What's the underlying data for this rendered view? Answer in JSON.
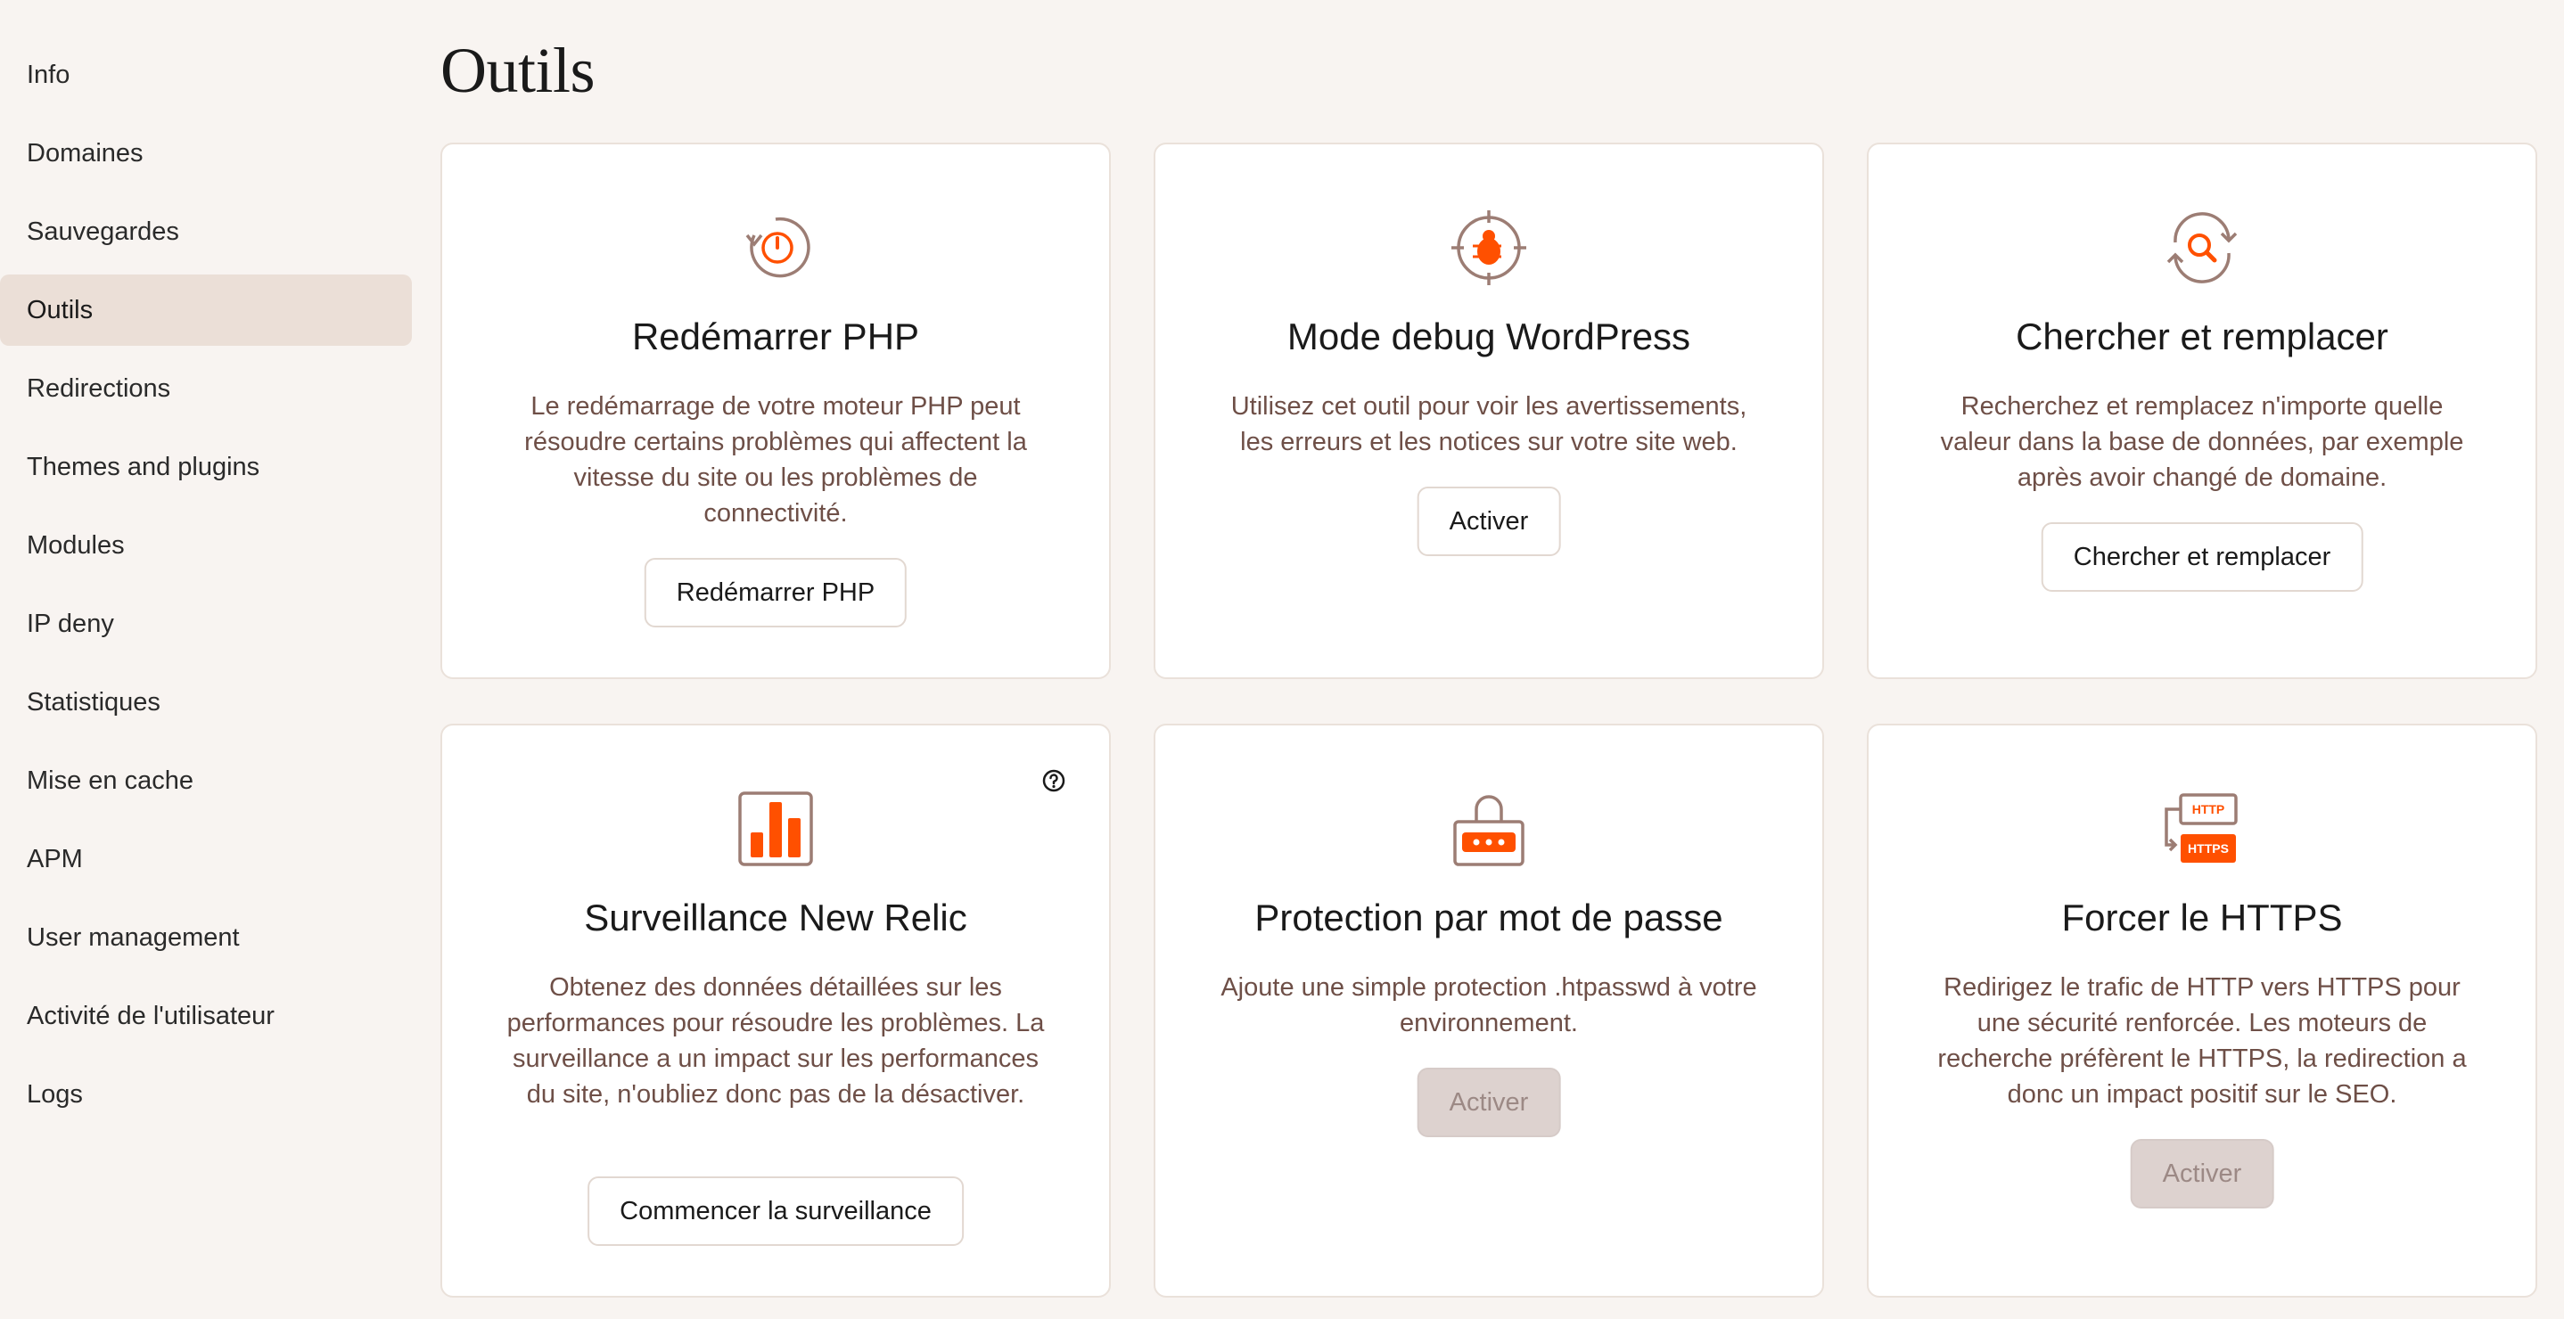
{
  "sidebar": {
    "items": [
      {
        "label": "Info"
      },
      {
        "label": "Domaines"
      },
      {
        "label": "Sauvegardes"
      },
      {
        "label": "Outils",
        "active": true
      },
      {
        "label": "Redirections"
      },
      {
        "label": "Themes and plugins"
      },
      {
        "label": "Modules"
      },
      {
        "label": "IP deny"
      },
      {
        "label": "Statistiques"
      },
      {
        "label": "Mise en cache"
      },
      {
        "label": "APM"
      },
      {
        "label": "User management"
      },
      {
        "label": "Activité de l'utilisateur"
      },
      {
        "label": "Logs"
      }
    ]
  },
  "page": {
    "title": "Outils"
  },
  "colors": {
    "accent": "#ff5000",
    "icon_stroke": "#9c7d74",
    "desc": "#6e4f47",
    "active_nav": "#ebdfd7"
  },
  "cards": [
    {
      "icon": "restart-power-icon",
      "title": "Redémarrer PHP",
      "description": "Le redémarrage de votre moteur PHP peut résoudre certains problèmes qui affectent la vitesse du site ou les problèmes de connectivité.",
      "button": "Redémarrer PHP",
      "button_disabled": false
    },
    {
      "icon": "bug-target-icon",
      "title": "Mode debug WordPress",
      "description": "Utilisez cet outil pour voir les avertissements, les erreurs et les notices sur votre site web.",
      "button": "Activer",
      "button_disabled": false
    },
    {
      "icon": "search-replace-icon",
      "title": "Chercher et remplacer",
      "description": "Recherchez et remplacez n'importe quelle valeur dans la base de données, par exemple après avoir changé de domaine.",
      "button": "Chercher et remplacer",
      "button_disabled": false
    },
    {
      "icon": "bar-chart-icon",
      "title": "Surveillance New Relic",
      "description": "Obtenez des données détaillées sur les performances pour résoudre les problèmes. La surveillance a un impact sur les performances du site, n'oubliez donc pas de la désactiver.",
      "button": "Commencer la surveillance",
      "button_disabled": false,
      "has_help": true
    },
    {
      "icon": "padlock-password-icon",
      "title": "Protection par mot de passe",
      "description": "Ajoute une simple protection .htpasswd à votre environnement.",
      "button": "Activer",
      "button_disabled": true
    },
    {
      "icon": "http-https-icon",
      "title": "Forcer le HTTPS",
      "description": "Redirigez le trafic de HTTP vers HTTPS pour une sécurité renforcée. Les moteurs de recherche préfèrent le HTTPS, la redirection a donc un impact positif sur le SEO.",
      "button": "Activer",
      "button_disabled": true,
      "icon_labels": {
        "top": "HTTP",
        "bottom": "HTTPS"
      }
    }
  ]
}
